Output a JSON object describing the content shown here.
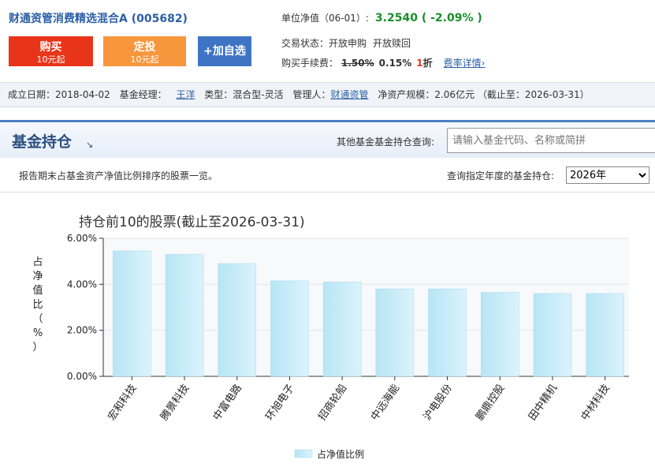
{
  "header": {
    "fund_title": "财通资管消费精选混合A (005682)",
    "buy": {
      "label": "购买",
      "sub": "10元起"
    },
    "plan": {
      "label": "定投",
      "sub": "10元起"
    },
    "fav_label": "+加自选",
    "nav_label": "单位净值（06-01）:",
    "nav_value": "3.2540 ( -2.09% )",
    "status_label": "交易状态：",
    "status_buy": "开放申购",
    "status_redeem": "开放赎回",
    "fee_label": "购买手续费：",
    "fee_old": "1.50%",
    "fee_new": "0.15%",
    "discount_num": "1",
    "discount_unit": "折",
    "fee_link": "费率详情›"
  },
  "info": {
    "date_label": "成立日期：",
    "date_value": "2018-04-02",
    "manager_label": "基金经理：",
    "manager_value": "王洋",
    "type_label": "类型：",
    "type_value": "混合型-灵活",
    "company_label": "管理人：",
    "company_value": "财通资管",
    "scale_label": "净资产规模：",
    "scale_value": "2.06亿元 （截止至：2026-03-31）"
  },
  "section": {
    "title": "基金持仓",
    "arrow": "↘",
    "other_query_label": "其他基金基金持仓查询:",
    "other_query_placeholder": "请输入基金代码、名称或简拼",
    "desc": "报告期末占基金资产净值比例排序的股票一览。",
    "year_label": "查询指定年度的基金持仓:",
    "year_selected": "2026年"
  },
  "colors": {
    "bar_fill": "#c5ebf7",
    "bar_stroke": "#a6dcef",
    "accent": "#2b5fa6"
  },
  "chart_data": {
    "type": "bar",
    "title": "持仓前10的股票(截止至2026-03-31)",
    "ylabel": "占净值比（%）",
    "ylabel_chars": [
      "占",
      "净",
      "值",
      "比",
      "（",
      "%",
      "）"
    ],
    "yticks": [
      "0.00%",
      "2.00%",
      "4.00%",
      "6.00%"
    ],
    "ylim": [
      0,
      6
    ],
    "categories": [
      "宏和科技",
      "腾景科技",
      "中富电路",
      "环旭电子",
      "招商轮船",
      "中远海能",
      "沪电股份",
      "鹏鼎控股",
      "田中精机",
      "中材科技"
    ],
    "series": [
      {
        "name": "占净值比例",
        "values": [
          5.45,
          5.3,
          4.9,
          4.15,
          4.1,
          3.8,
          3.8,
          3.65,
          3.6,
          3.6
        ]
      }
    ],
    "grid": true,
    "legend": "bottom-center"
  }
}
